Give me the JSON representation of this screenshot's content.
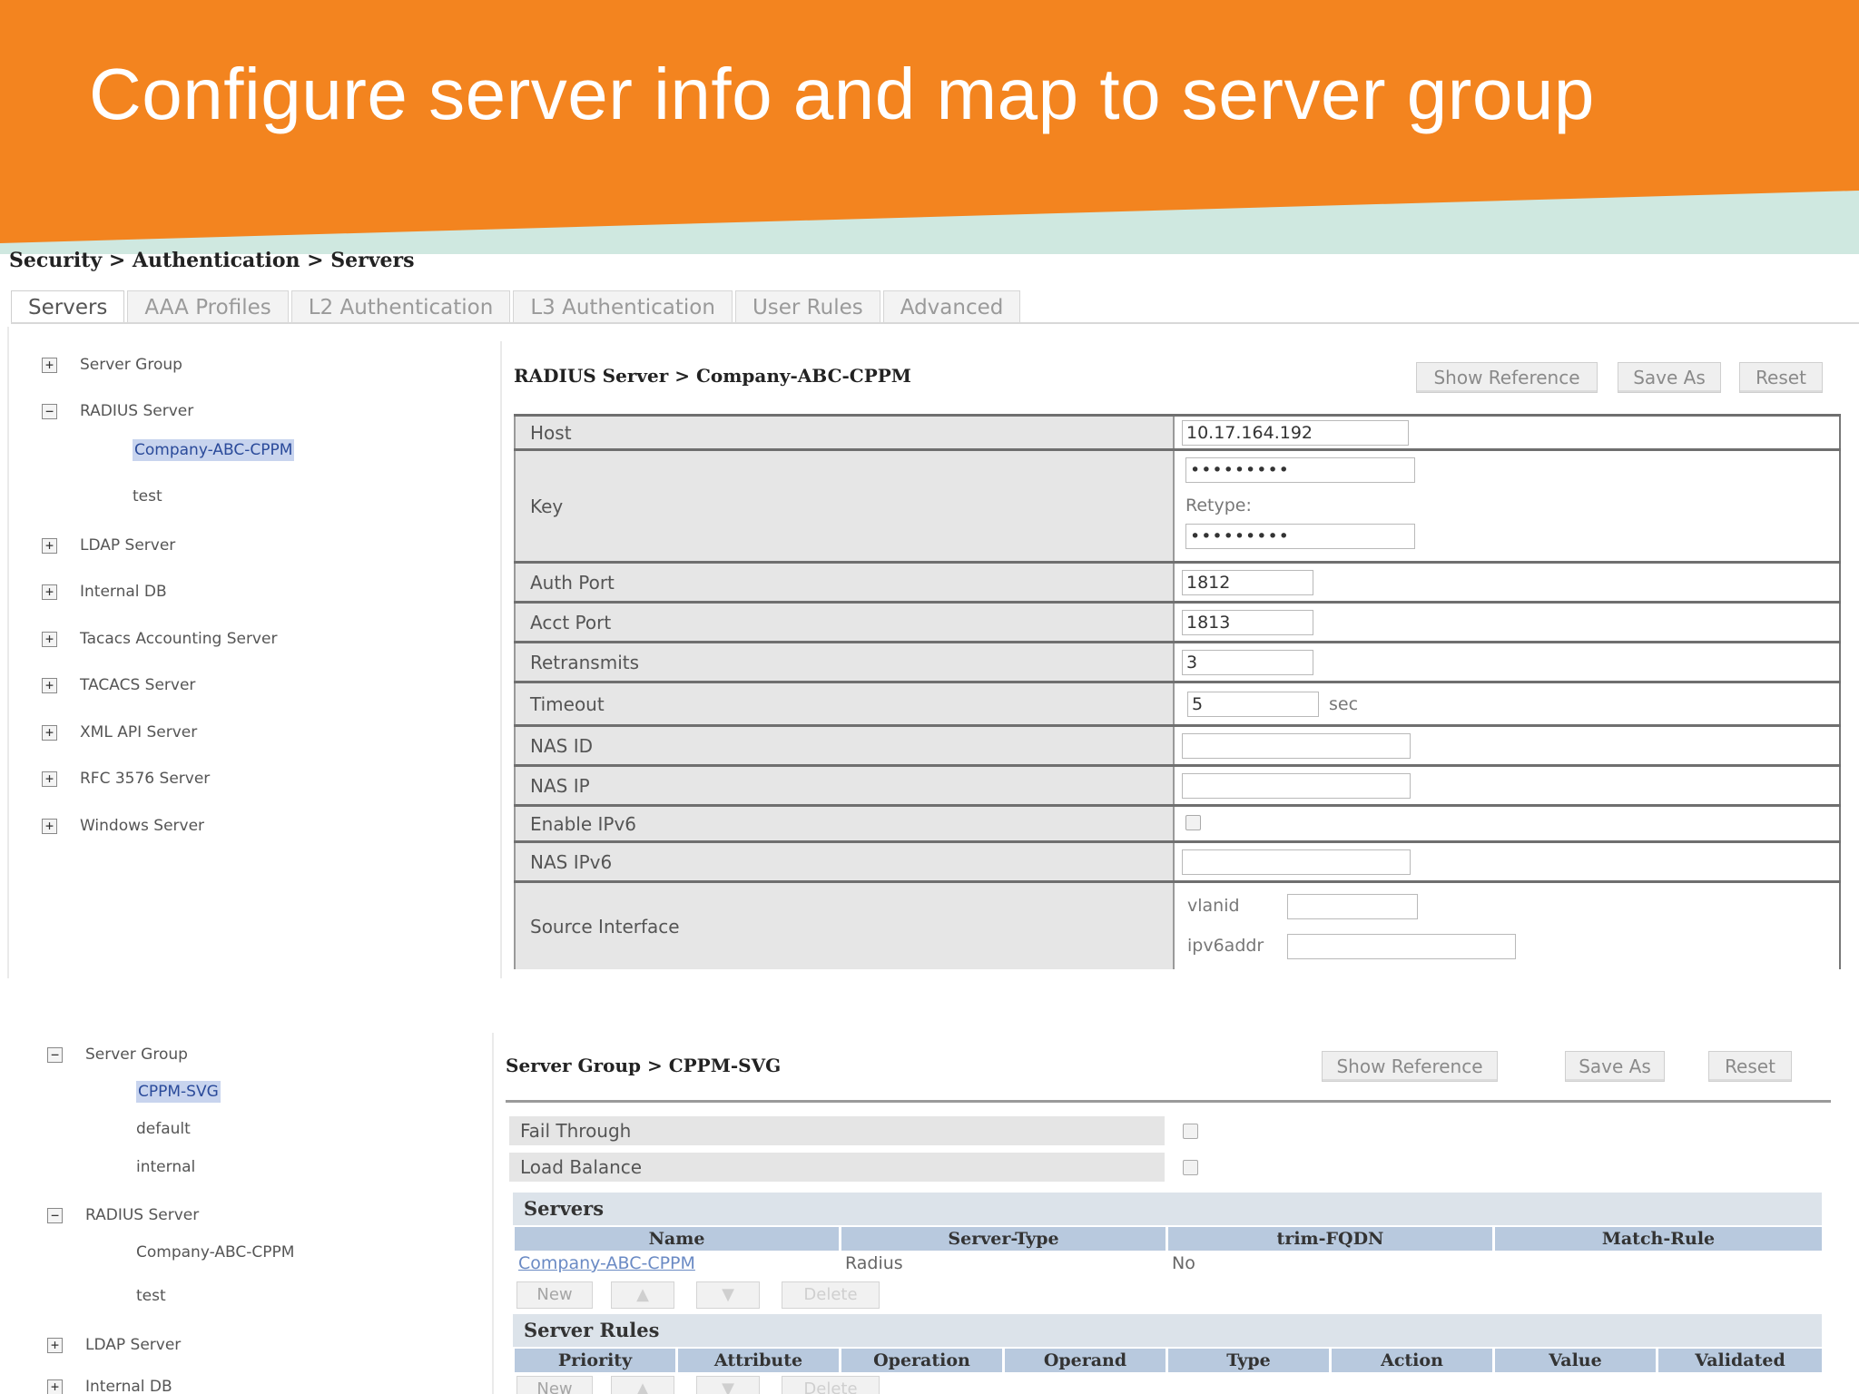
{
  "slide": {
    "title": "Configure server info and map to server group",
    "colors": {
      "orange": "#F3841F",
      "teal": "#cfe8e0",
      "selection": "#c8d4ee",
      "header_row": "#b8c9de",
      "link": "#6a8ac4"
    }
  },
  "breadcrumb": "Security > Authentication > Servers",
  "tabs": [
    "Servers",
    "AAA Profiles",
    "L2 Authentication",
    "L3 Authentication",
    "User Rules",
    "Advanced"
  ],
  "tabs_active": "Servers",
  "tree_top": {
    "nodes": [
      {
        "icon": "expand-icon",
        "symbol": "+",
        "label": "Server Group"
      },
      {
        "icon": "collapse-icon",
        "symbol": "−",
        "label": "RADIUS Server",
        "children": [
          "Company-ABC-CPPM",
          "test"
        ],
        "selected": "Company-ABC-CPPM"
      },
      {
        "icon": "expand-icon",
        "symbol": "+",
        "label": "LDAP Server"
      },
      {
        "icon": "expand-icon",
        "symbol": "+",
        "label": "Internal DB"
      },
      {
        "icon": "expand-icon",
        "symbol": "+",
        "label": "Tacacs Accounting Server"
      },
      {
        "icon": "expand-icon",
        "symbol": "+",
        "label": "TACACS Server"
      },
      {
        "icon": "expand-icon",
        "symbol": "+",
        "label": "XML API Server"
      },
      {
        "icon": "expand-icon",
        "symbol": "+",
        "label": "RFC 3576 Server"
      },
      {
        "icon": "expand-icon",
        "symbol": "+",
        "label": "Windows Server"
      }
    ]
  },
  "radius_panel": {
    "title": "RADIUS Server > Company-ABC-CPPM",
    "buttons": {
      "show_reference": "Show Reference",
      "save_as": "Save As",
      "reset": "Reset"
    },
    "fields": {
      "host": {
        "label": "Host",
        "value": "10.17.164.192"
      },
      "key": {
        "label": "Key",
        "value": "•••••••••",
        "retype_label": "Retype:",
        "retype_value": "•••••••••"
      },
      "auth_port": {
        "label": "Auth Port",
        "value": "1812"
      },
      "acct_port": {
        "label": "Acct Port",
        "value": "1813"
      },
      "retransmits": {
        "label": "Retransmits",
        "value": "3"
      },
      "timeout": {
        "label": "Timeout",
        "value": "5",
        "unit": "sec"
      },
      "nas_id": {
        "label": "NAS ID",
        "value": ""
      },
      "nas_ip": {
        "label": "NAS IP",
        "value": ""
      },
      "enable_ipv6": {
        "label": "Enable IPv6",
        "checked": false
      },
      "nas_ipv6": {
        "label": "NAS IPv6",
        "value": ""
      },
      "source_interface": {
        "label": "Source Interface",
        "vlanid_label": "vlanid",
        "vlanid_value": "",
        "ipv6addr_label": "ipv6addr",
        "ipv6addr_value": ""
      }
    }
  },
  "tree_bottom": {
    "nodes": [
      {
        "icon": "collapse-icon",
        "symbol": "−",
        "label": "Server Group",
        "children": [
          "CPPM-SVG",
          "default",
          "internal"
        ],
        "selected": "CPPM-SVG"
      },
      {
        "icon": "collapse-icon",
        "symbol": "−",
        "label": "RADIUS Server",
        "children": [
          "Company-ABC-CPPM",
          "test"
        ]
      },
      {
        "icon": "expand-icon",
        "symbol": "+",
        "label": "LDAP Server"
      },
      {
        "icon": "expand-icon",
        "symbol": "+",
        "label": "Internal DB"
      }
    ]
  },
  "group_panel": {
    "title": "Server Group > CPPM-SVG",
    "buttons": {
      "show_reference": "Show Reference",
      "save_as": "Save As",
      "reset": "Reset"
    },
    "fail_through": {
      "label": "Fail Through",
      "checked": false
    },
    "load_balance": {
      "label": "Load Balance",
      "checked": false
    },
    "servers": {
      "title": "Servers",
      "columns": [
        "Name",
        "Server-Type",
        "trim-FQDN",
        "Match-Rule"
      ],
      "rows": [
        {
          "name": "Company-ABC-CPPM",
          "server_type": "Radius",
          "trim_fqdn": "No",
          "match_rule": ""
        }
      ],
      "buttons": {
        "new": "New",
        "up": "▲",
        "down": "▼",
        "delete": "Delete"
      }
    },
    "server_rules": {
      "title": "Server Rules",
      "columns": [
        "Priority",
        "Attribute",
        "Operation",
        "Operand",
        "Type",
        "Action",
        "Value",
        "Validated"
      ],
      "buttons": {
        "new": "New",
        "up": "▲",
        "down": "▼",
        "delete": "Delete"
      }
    }
  }
}
